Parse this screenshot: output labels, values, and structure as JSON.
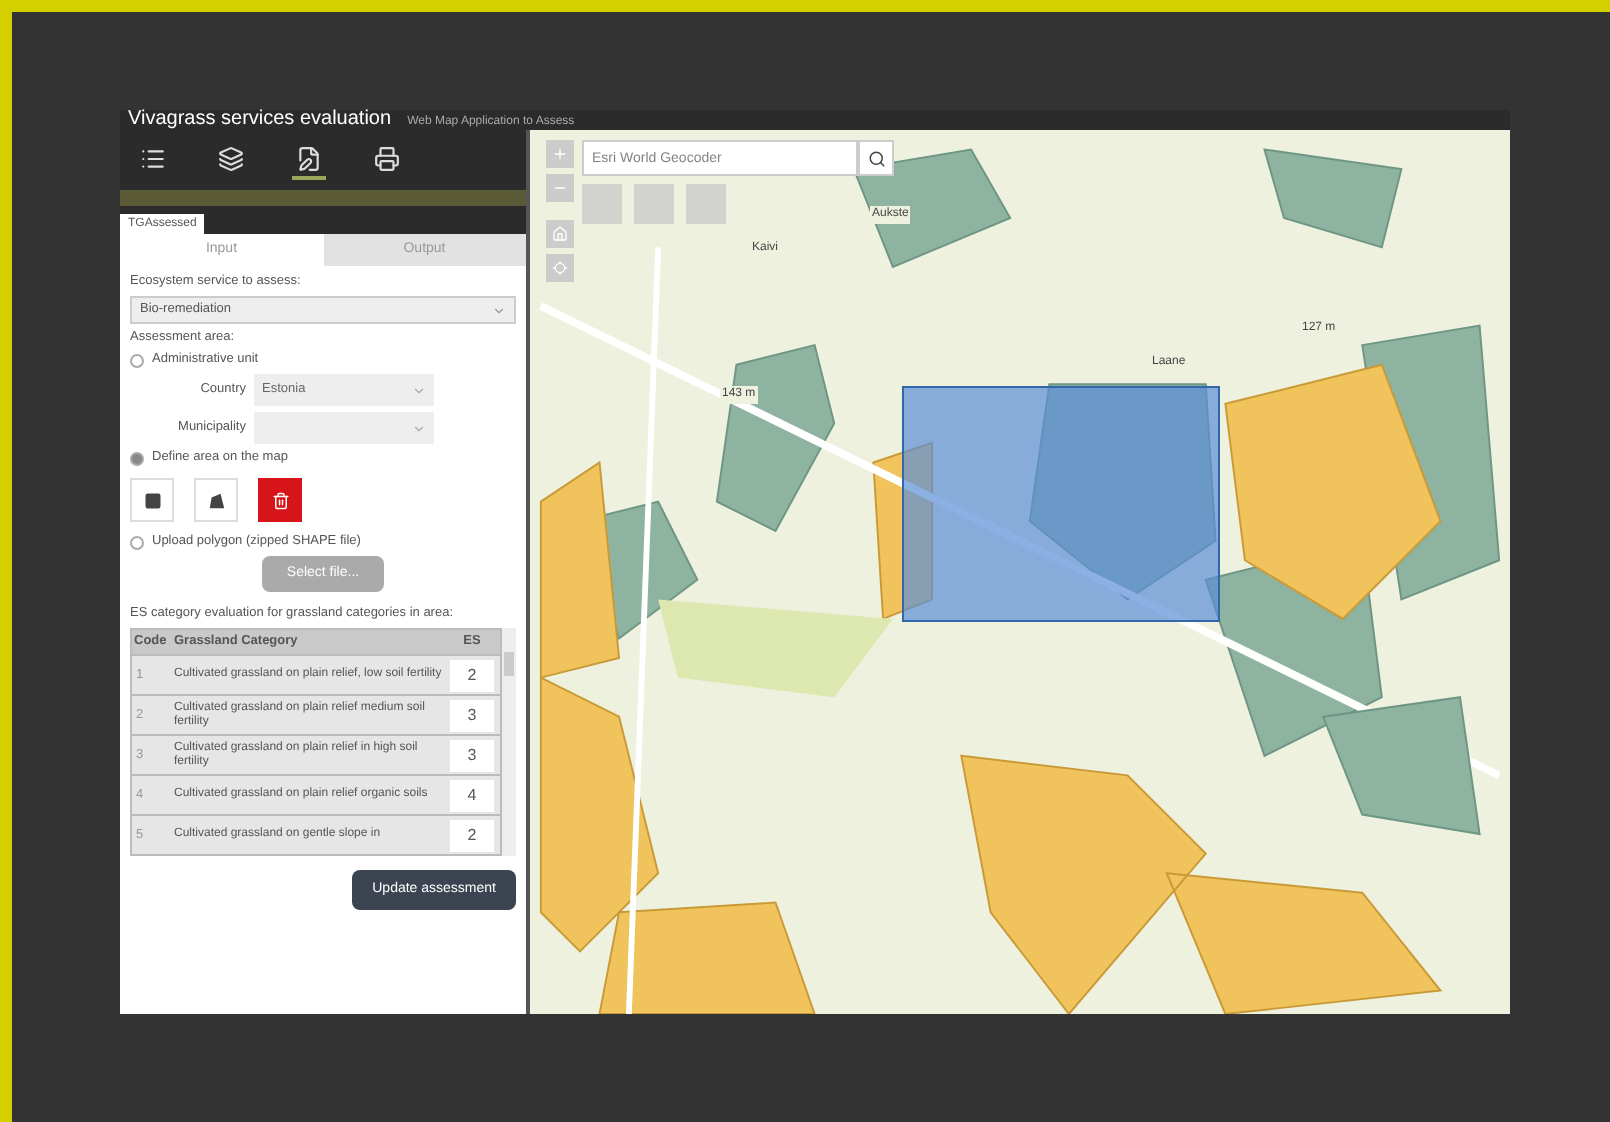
{
  "app": {
    "title": "Vivagrass services evaluation",
    "subtitle": "Web Map Application to Assess"
  },
  "toolbar": [
    {
      "kind": "list",
      "selected": false
    },
    {
      "kind": "layers",
      "selected": false
    },
    {
      "kind": "edit",
      "selected": true
    },
    {
      "kind": "print",
      "selected": false
    }
  ],
  "panel_tab": "TGAssessed",
  "tabs": [
    {
      "label": "Input",
      "selected": true
    },
    {
      "label": "Output",
      "selected": false
    }
  ],
  "service": {
    "label": "Ecosystem service to assess:",
    "value": "Bio-remediation"
  },
  "area": {
    "label": "Assessment area:",
    "options": [
      {
        "label": "Administrative unit",
        "selected": false
      },
      {
        "label": "Define area on the map",
        "selected": true
      },
      {
        "label": "Upload polygon (zipped SHAPE file)",
        "selected": false
      }
    ],
    "country": {
      "label": "Country",
      "value": "Estonia"
    },
    "municipality": {
      "label": "Municipality"
    },
    "tools": [
      {
        "kind": "rectangle",
        "active": false
      },
      {
        "kind": "polygon",
        "active": false
      },
      {
        "kind": "delete",
        "active": true
      }
    ],
    "select_file": "Select file..."
  },
  "table": {
    "caption": "ES category evaluation for grassland categories in area:",
    "columns": [
      "Code",
      "Grassland Category",
      "ES"
    ],
    "rows": [
      {
        "code": "1",
        "category": "Cultivated grassland on plain relief, low soil fertility",
        "value": "2"
      },
      {
        "code": "2",
        "category": "Cultivated grassland on plain relief medium soil fertility",
        "value": "3"
      },
      {
        "code": "3",
        "category": "Cultivated grassland on plain relief in high soil fertility",
        "value": "3"
      },
      {
        "code": "4",
        "category": "Cultivated grassland on plain relief organic soils",
        "value": "4"
      },
      {
        "code": "5",
        "category": "Cultivated grassland on gentle slope in",
        "value": "2"
      }
    ]
  },
  "update_button": "Update assessment",
  "map": {
    "search_placeholder": "Esri World Geocoder",
    "labels": [
      "Kaivi",
      "Aukste",
      "Laane",
      "143 m",
      "127 m"
    ]
  }
}
